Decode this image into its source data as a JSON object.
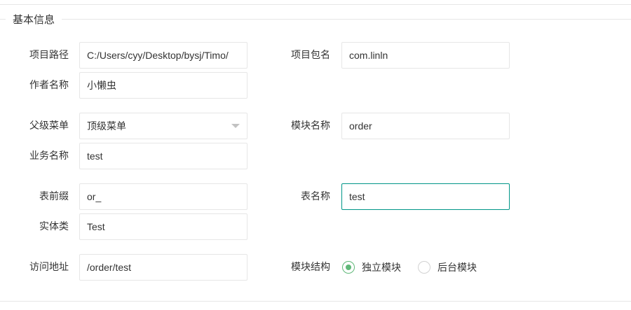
{
  "section": {
    "title": "基本信息"
  },
  "fields": {
    "project_path": {
      "label": "项目路径",
      "value": "C:/Users/cyy/Desktop/bysj/Timo/"
    },
    "package_name": {
      "label": "项目包名",
      "value": "com.linln"
    },
    "author_name": {
      "label": "作者名称",
      "value": "小懒虫"
    },
    "parent_menu": {
      "label": "父级菜单",
      "value": "顶级菜单"
    },
    "module_name": {
      "label": "模块名称",
      "value": "order"
    },
    "business_name": {
      "label": "业务名称",
      "value": "test"
    },
    "table_prefix": {
      "label": "表前缀",
      "value": "or_"
    },
    "table_name": {
      "label": "表名称",
      "value": "test"
    },
    "entity_class": {
      "label": "实体类",
      "value": "Test"
    },
    "access_url": {
      "label": "访问地址",
      "value": "/order/test"
    },
    "module_structure": {
      "label": "模块结构",
      "options": [
        {
          "label": "独立模块",
          "checked": true
        },
        {
          "label": "后台模块",
          "checked": false
        }
      ]
    }
  },
  "colors": {
    "focus_border": "#009688",
    "radio_checked": "#5fb878",
    "border": "#e6e6e6"
  }
}
